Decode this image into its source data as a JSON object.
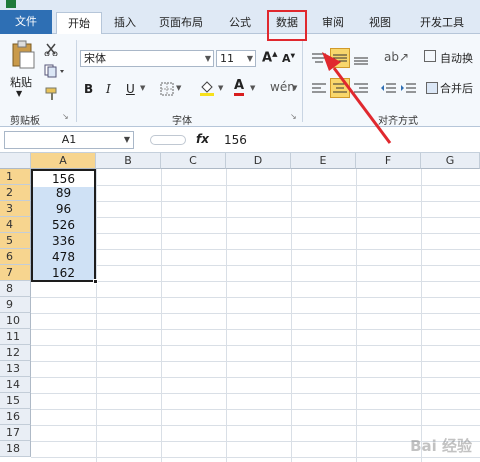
{
  "tabs": [
    {
      "label": "文件"
    },
    {
      "label": "开始"
    },
    {
      "label": "插入"
    },
    {
      "label": "页面布局"
    },
    {
      "label": "公式"
    },
    {
      "label": "数据"
    },
    {
      "label": "审阅"
    },
    {
      "label": "视图"
    },
    {
      "label": "开发工具"
    }
  ],
  "ribbon": {
    "paste_label": "粘贴",
    "clipboard_label": "剪贴板",
    "font_name": "宋体",
    "font_size": "11",
    "font_group_label": "字体",
    "align_group_label": "对齐方式",
    "wrap_label": "自动换",
    "merge_label": "合并后"
  },
  "formula_bar": {
    "name_box": "A1",
    "fx": "fx",
    "value": "156"
  },
  "columns": [
    "A",
    "B",
    "C",
    "D",
    "E",
    "F",
    "G"
  ],
  "rows": [
    "1",
    "2",
    "3",
    "4",
    "5",
    "6",
    "7",
    "8",
    "9",
    "10",
    "11",
    "12",
    "13",
    "14",
    "15",
    "16",
    "17",
    "18"
  ],
  "cells_a": [
    "156",
    "89",
    "96",
    "526",
    "336",
    "478",
    "162"
  ],
  "colors": {
    "highlight_box": "#e0282e",
    "arrow": "#e0282e",
    "file_tab": "#2e6fb4",
    "selection": "#cfe1f5"
  },
  "watermark": "Bai 经验"
}
